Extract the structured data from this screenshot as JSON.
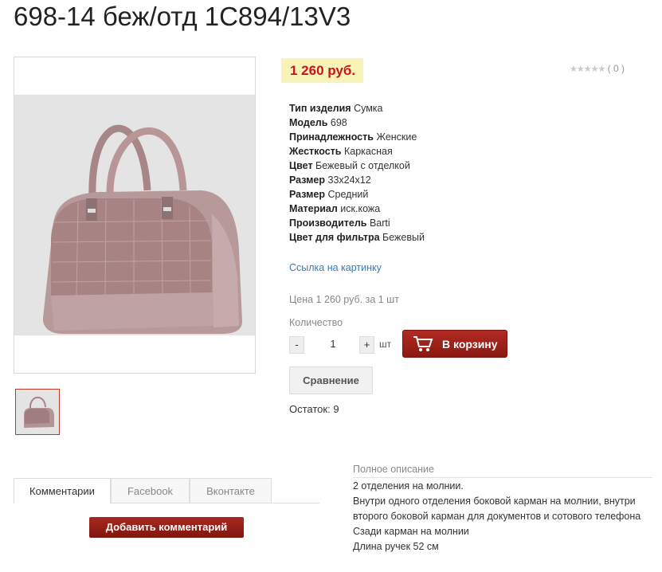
{
  "product": {
    "title": "698-14 беж/отд 1С894/13V3",
    "price": "1 260 руб.",
    "rating_count": "( 0 )",
    "rating_stars": "★★★★★",
    "props": [
      {
        "label": "Тип изделия",
        "value": "Сумка"
      },
      {
        "label": "Модель",
        "value": "698"
      },
      {
        "label": "Принадлежность",
        "value": "Женские"
      },
      {
        "label": "Жесткость",
        "value": "Каркасная"
      },
      {
        "label": "Цвет",
        "value": "Бежевый с отделкой"
      },
      {
        "label": "Размер",
        "value": "33х24х12"
      },
      {
        "label": "Размер",
        "value": "Средний"
      },
      {
        "label": "Материал",
        "value": "иск.кожа"
      },
      {
        "label": "Производитель",
        "value": "Barti"
      },
      {
        "label": "Цвет для фильтра",
        "value": "Бежевый"
      }
    ],
    "image_link": "Ссылка на картинку",
    "unit_price": "Цена 1 260 руб. за 1 шт",
    "quantity_label": "Количество",
    "quantity": "1",
    "minus": "-",
    "plus": "+",
    "unit": "шт",
    "cart_button": "В корзину",
    "compare_button": "Сравнение",
    "stock": "Остаток: 9"
  },
  "tabs": [
    "Комментарии",
    "Facebook",
    "Вконтакте"
  ],
  "add_comment_button": "Добавить комментарий",
  "description": {
    "title": "Полное описание",
    "lines": [
      "2 отделения на молнии.",
      "Внутри одного отделения боковой карман на молнии, внутри второго боковой карман для документов и сотового телефона",
      "Сзади карман на молнии",
      "Длина ручек 52 см"
    ]
  },
  "colors": {
    "price_text": "#c4161c",
    "price_bg": "#f8f4b8",
    "button_red": "#9e241b",
    "link": "#3a7ab8"
  }
}
